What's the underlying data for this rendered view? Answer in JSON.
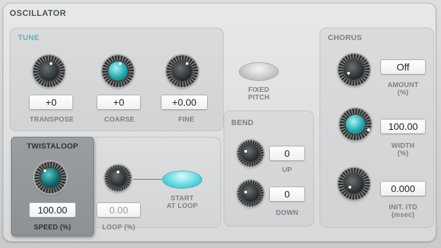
{
  "oscillator": {
    "title": "OSCILLATOR",
    "tune": {
      "label": "TUNE",
      "transpose": {
        "value": "+0",
        "label": "TRANSPOSE"
      },
      "coarse": {
        "value": "+0",
        "label": "COARSE"
      },
      "fine": {
        "value": "+0.00",
        "label": "FINE"
      },
      "fixed_pitch": {
        "label_line1": "FIXED",
        "label_line2": "PITCH"
      }
    },
    "bend": {
      "label": "BEND",
      "up": {
        "value": "0",
        "label": "UP"
      },
      "down": {
        "value": "0",
        "label": "DOWN"
      }
    },
    "chorus": {
      "label": "CHORUS",
      "amount": {
        "value": "Off",
        "label": "AMOUNT",
        "unit": "(%)"
      },
      "width": {
        "value": "100.00",
        "label": "WIDTH",
        "unit": "(%)"
      },
      "init_itd": {
        "value": "0.000",
        "label": "INIT. ITD",
        "unit": "(msec)"
      }
    },
    "twistaloop": {
      "label": "TWISTALOOP",
      "speed": {
        "value": "100.00",
        "label": "SPEED (%)"
      },
      "loop": {
        "value": "0.00",
        "label": "LOOP (%)"
      },
      "start_at_loop": {
        "label_line1": "START",
        "label_line2": "AT LOOP"
      }
    }
  },
  "colors": {
    "accent": "#56b8c0",
    "panel": "#d7d9da",
    "twistaloop_bg": "#8f9396"
  },
  "icons": [
    "knob",
    "toggle-button"
  ]
}
